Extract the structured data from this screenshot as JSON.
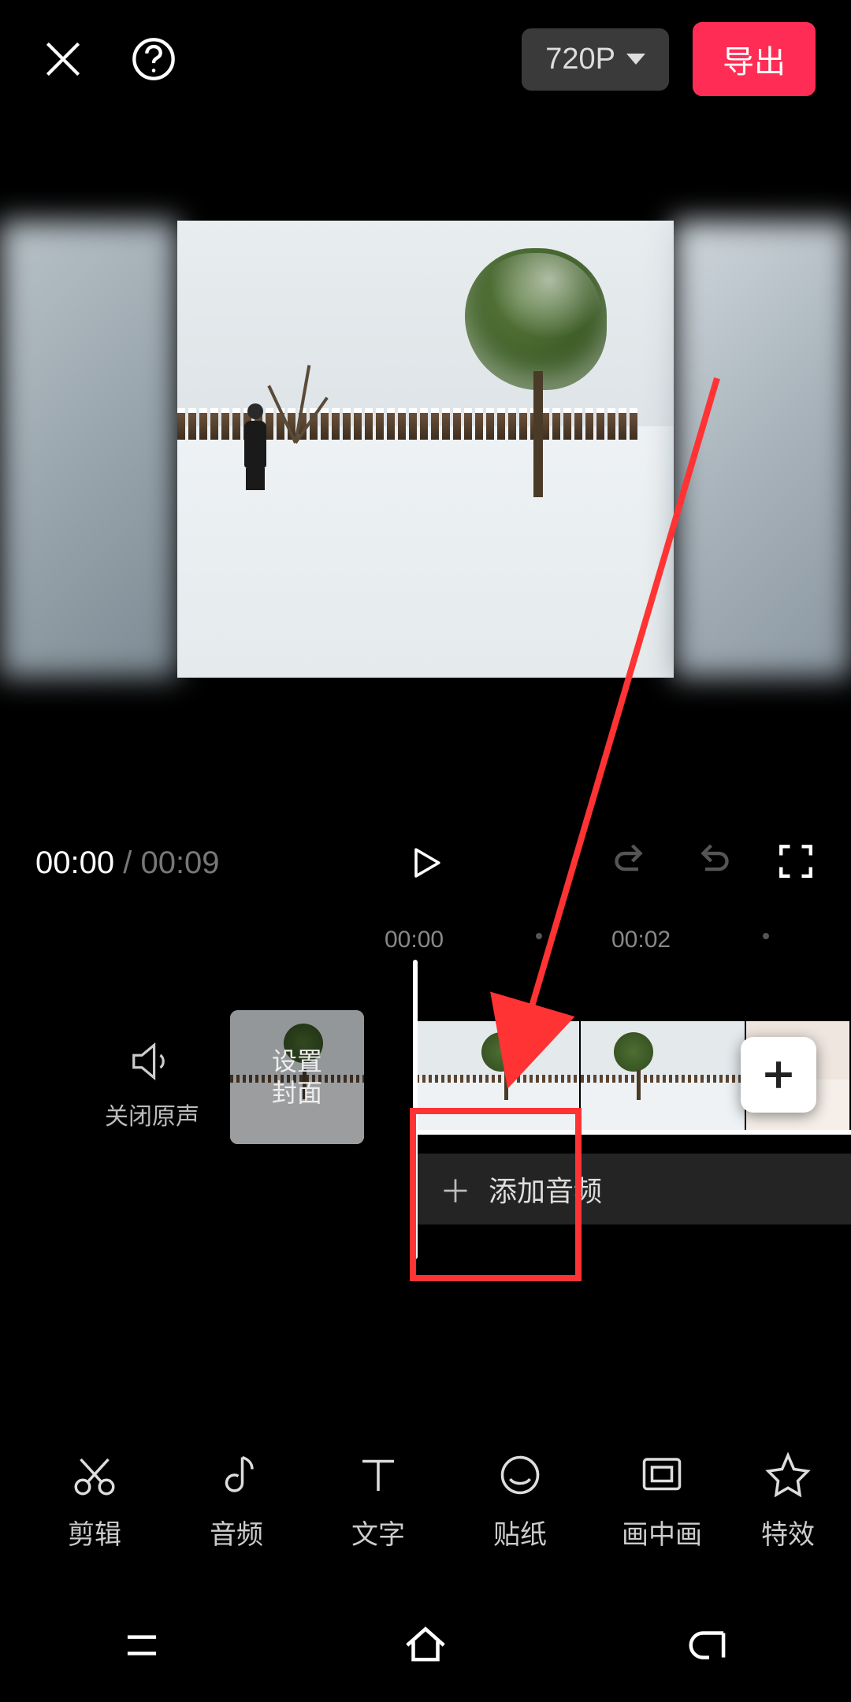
{
  "header": {
    "resolution_label": "720P",
    "export_label": "导出"
  },
  "playback": {
    "current_time": "00:00",
    "separator": " / ",
    "duration": "00:09"
  },
  "ruler": {
    "tick0": "00:00",
    "tick1": "00:02"
  },
  "timeline": {
    "mute_label": "关闭原声",
    "cover_label": "设置\n封面",
    "add_audio_label": "添加音频"
  },
  "toolbar": {
    "items": [
      {
        "label": "剪辑"
      },
      {
        "label": "音频"
      },
      {
        "label": "文字"
      },
      {
        "label": "贴纸"
      },
      {
        "label": "画中画"
      },
      {
        "label": "特效"
      }
    ]
  },
  "annotation": {
    "highlight_target": "add-audio-bar"
  },
  "colors": {
    "accent": "#ff2d55",
    "annotation": "#ff3333"
  }
}
